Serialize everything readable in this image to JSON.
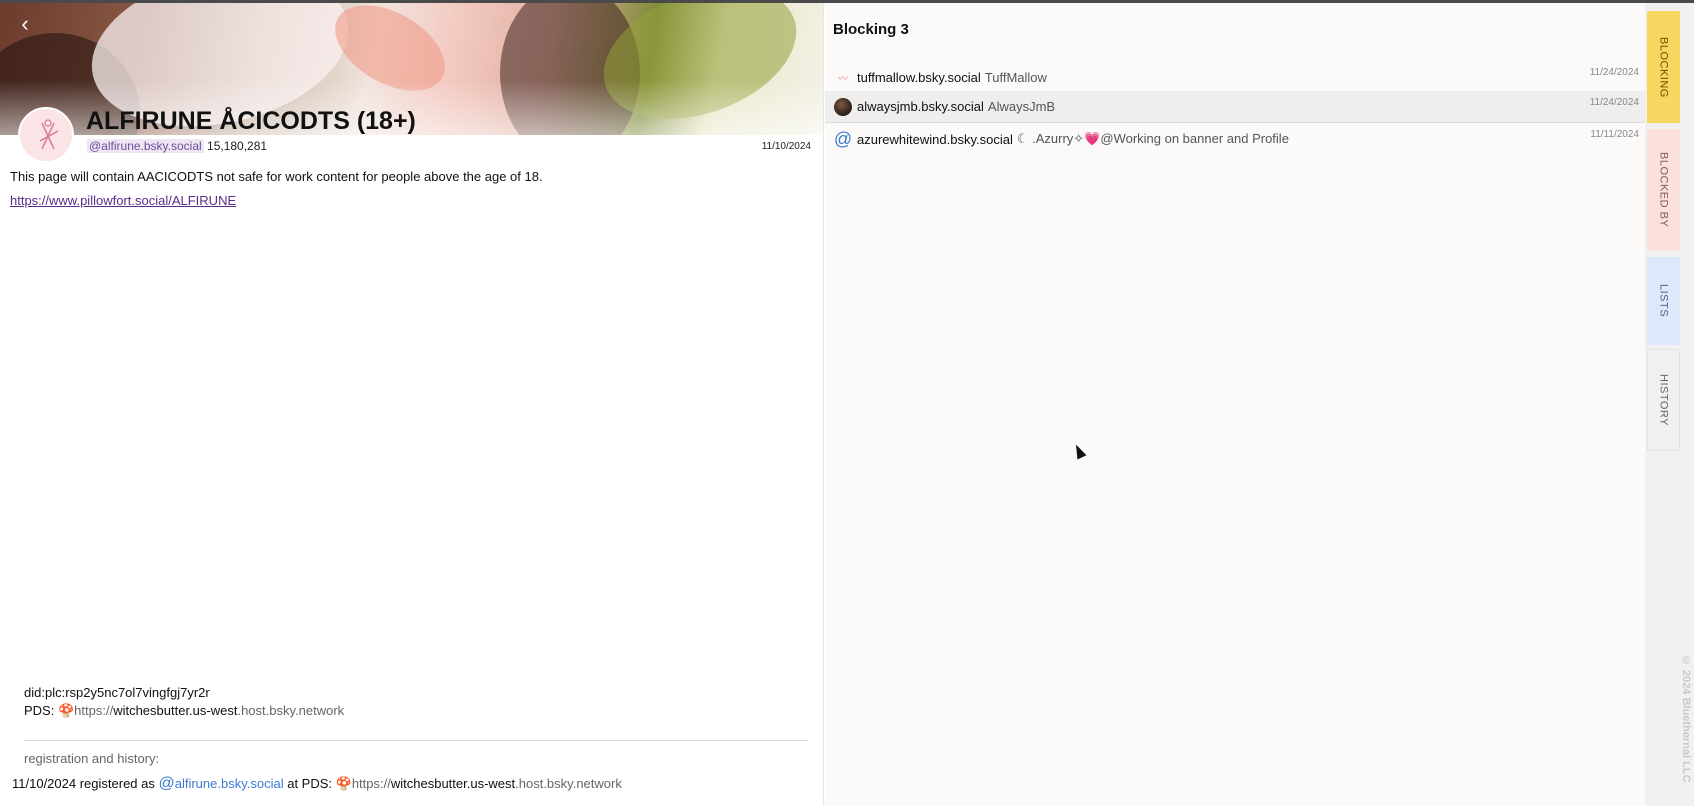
{
  "profile": {
    "back_label": "‹",
    "name": "ALFIRUNE ÅCICODTS (18+)",
    "handle": "@alfirune.bsky.social",
    "followers": "15,180,281",
    "date": "11/10/2024",
    "bio": "This page will contain AACICODTS not safe for work content for people above the age of 18.",
    "link": "https://www.pillowfort.social/ALFIRUNE",
    "did": "did:plc:rsp2y5nc7ol7vingfgj7yr2r",
    "pds_label": "PDS: ",
    "pds_prefix": "https://",
    "pds_host_main": "witchesbutter.us-west",
    "pds_host_rest": ".host.bsky.network",
    "registration_title": "registration and history:",
    "registration": {
      "date": "11/10/2024",
      "registered_as": " registered as ",
      "at_symbol": "@",
      "handle": "alfirune.bsky.social",
      "at_pds": " at PDS: ",
      "pds_prefix": "https://",
      "pds_host_main": "witchesbutter.us-west",
      "pds_host_rest": ".host.bsky.network"
    }
  },
  "blocking": {
    "title": "Blocking 3",
    "items": [
      {
        "handle": "tuffmallow.bsky.social",
        "display": "TuffMallow",
        "date": "11/24/2024",
        "icon": "small-avatar-icon"
      },
      {
        "handle": "alwaysjmb.bsky.social",
        "display": "AlwaysJmB",
        "date": "11/24/2024",
        "icon": "avatar-icon"
      },
      {
        "handle": "azurewhitewind.bsky.social",
        "display": "☾ .Azurry✧💗@Working on banner and Profile",
        "date": "11/11/2024",
        "icon": "at-icon",
        "icon_glyph": "@"
      }
    ]
  },
  "tabs": {
    "blocking": "BLOCKING",
    "blocked_by": "BLOCKED BY",
    "lists": "LISTS",
    "history": "HISTORY"
  },
  "footer": {
    "copyright": "© 2024 Bluethernal LLC"
  },
  "colors": {
    "accent_blocking": "#f7d760",
    "accent_blocked_by": "#fbe0db",
    "accent_lists": "#dde8fb",
    "link": "#3c7bd1"
  }
}
